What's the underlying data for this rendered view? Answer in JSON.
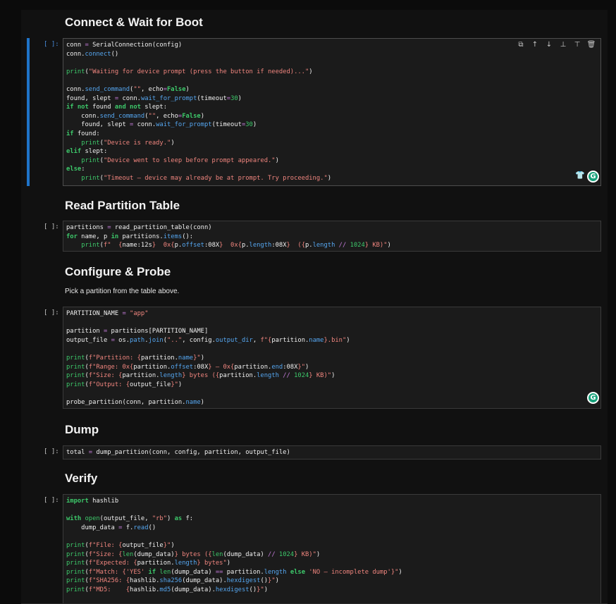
{
  "sections": {
    "connect": "Connect & Wait for Boot",
    "partition_table": "Read Partition Table",
    "configure": "Configure & Probe",
    "configure_desc": "Pick a partition from the table above.",
    "dump": "Dump",
    "verify": "Verify"
  },
  "prompts": {
    "cell1": "[ ]:",
    "cell2": "[ ]:",
    "cell3": "[ ]:",
    "cell4": "[ ]:",
    "cell5": "[ ]:"
  },
  "toolbar": {
    "icons": [
      "copy-icon",
      "move-up-icon",
      "move-down-icon",
      "insert-below-icon",
      "insert-above-icon",
      "delete-icon"
    ]
  },
  "grammarly_label": "G",
  "colors": {
    "background": "#111111",
    "editor_bg": "#1b1b1b",
    "keyword": "#3dc86a",
    "function": "#55a6f0",
    "string": "#f0857e",
    "operator": "#c37bd9",
    "selection": "#1f74c9"
  }
}
